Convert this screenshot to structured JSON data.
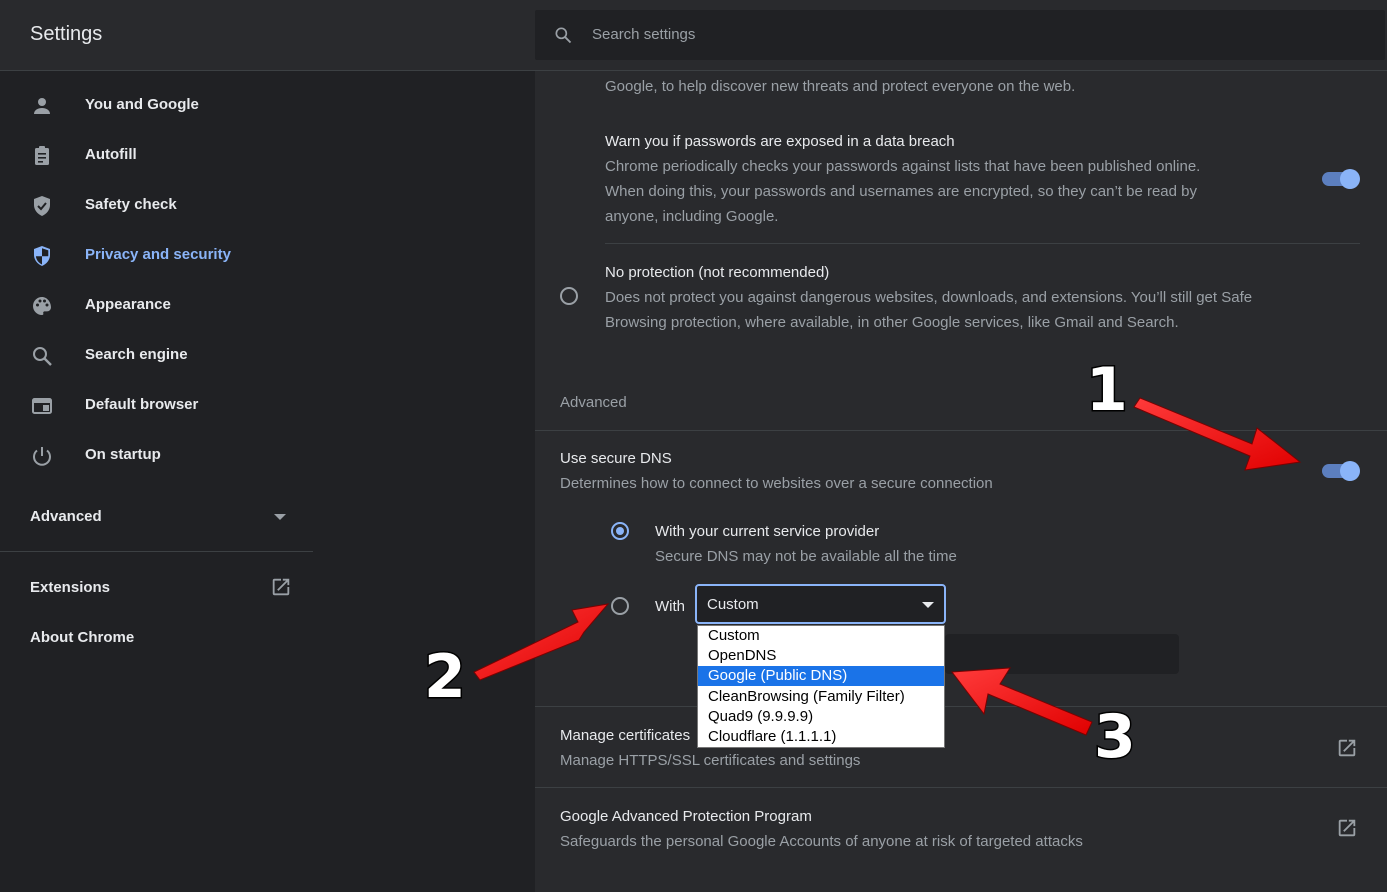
{
  "header": {
    "title": "Settings",
    "search_placeholder": "Search settings"
  },
  "sidebar": {
    "items": [
      {
        "label": "You and Google",
        "icon": "person-icon"
      },
      {
        "label": "Autofill",
        "icon": "clipboard-icon"
      },
      {
        "label": "Safety check",
        "icon": "shield-check-icon"
      },
      {
        "label": "Privacy and security",
        "icon": "shield-icon",
        "active": true
      },
      {
        "label": "Appearance",
        "icon": "palette-icon"
      },
      {
        "label": "Search engine",
        "icon": "search-icon"
      },
      {
        "label": "Default browser",
        "icon": "browser-window-icon"
      },
      {
        "label": "On startup",
        "icon": "power-icon"
      }
    ],
    "advanced_label": "Advanced",
    "extensions_label": "Extensions",
    "about_label": "About Chrome"
  },
  "main": {
    "top_fragment": "Google, to help discover new threats and protect everyone on the web.",
    "warn_passwords": {
      "title": "Warn you if passwords are exposed in a data breach",
      "desc_line1": "Chrome periodically checks your passwords against lists that have been published online.",
      "desc_line2": "When doing this, your passwords and usernames are encrypted, so they can’t be read by",
      "desc_line3": "anyone, including Google.",
      "enabled": true
    },
    "no_protection": {
      "title": "No protection (not recommended)",
      "desc_line1": "Does not protect you against dangerous websites, downloads, and extensions. You’ll still get Safe",
      "desc_line2": "Browsing protection, where available, in other Google services, like Gmail and Search."
    },
    "advanced_heading": "Advanced",
    "secure_dns": {
      "title": "Use secure DNS",
      "desc": "Determines how to connect to websites over a secure connection",
      "enabled": true,
      "option_current": {
        "title": "With your current service provider",
        "desc": "Secure DNS may not be available all the time"
      },
      "option_with_label": "With",
      "selected_value": "Custom",
      "dropdown_options": [
        "Custom",
        "OpenDNS",
        "Google (Public DNS)",
        "CleanBrowsing (Family Filter)",
        "Quad9 (9.9.9.9)",
        "Cloudflare (1.1.1.1)"
      ],
      "highlighted_option": "Google (Public DNS)"
    },
    "manage_certs": {
      "title": "Manage certificates",
      "desc": "Manage HTTPS/SSL certificates and settings"
    },
    "advanced_protection": {
      "title": "Google Advanced Protection Program",
      "desc": "Safeguards the personal Google Accounts of anyone at risk of targeted attacks"
    }
  },
  "annotations": {
    "step1": "1",
    "step2": "2",
    "step3": "3",
    "arrow_color": "#ff1a1a"
  },
  "colors": {
    "accent": "#8ab4f8",
    "background": "#202124",
    "surface": "#292a2d"
  }
}
